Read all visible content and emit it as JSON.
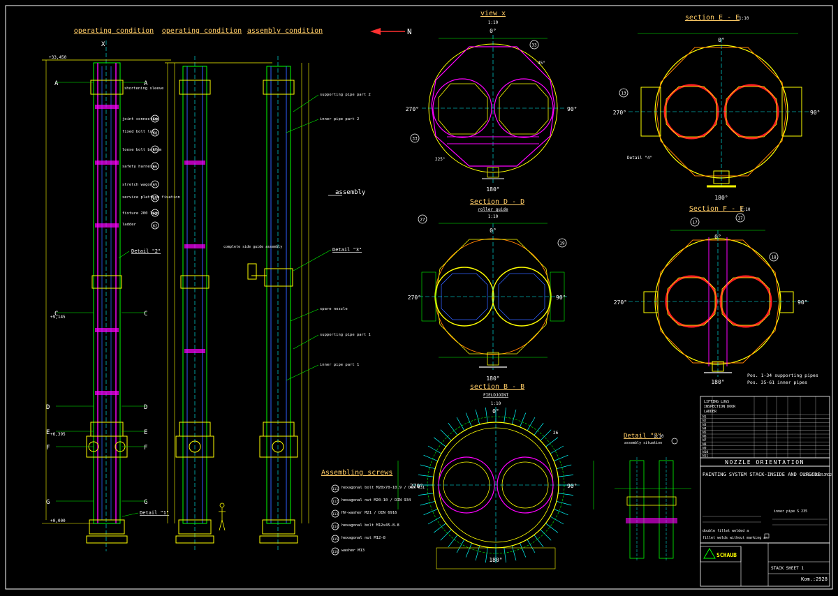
{
  "views": {
    "col1_title": "operating condition",
    "col2_title": "operating condition",
    "col3_title": "assembly condition",
    "north_label": "N",
    "view_x": {
      "title": "view x",
      "scale": "1:10"
    },
    "section_ee": {
      "title": "section E - E",
      "scale": "1:10"
    },
    "section_dd": {
      "title": "Section D - D",
      "subtitle": "roller guide",
      "scale": "1:10"
    },
    "section_ff": {
      "title": "Section F - F",
      "scale": "1:10"
    },
    "section_bb": {
      "title": "section B - B",
      "subtitle": "FIELDJOINT",
      "scale": "1:10"
    },
    "detail3": {
      "title": "Detail \"3\"",
      "scale": "1:10",
      "subtitle": "assembly situation"
    }
  },
  "angles": {
    "a0": "0°",
    "a90": "90°",
    "a180": "180°",
    "a270": "270°",
    "a45": "45°",
    "a225": "225°"
  },
  "section_letters": {
    "A": "A",
    "C": "C",
    "D": "D",
    "E": "E",
    "F": "F",
    "G": "G",
    "X": "X"
  },
  "details": {
    "d1": "Detail \"1\"",
    "d2": "Detail \"2\"",
    "d3": "Detail \"3\"",
    "d4": "Detail \"4\""
  },
  "assembly_marker": "assembly",
  "callouts": [
    {
      "text": "joint connection",
      "num": "69"
    },
    {
      "text": "fixed bolt lug",
      "num": "68"
    },
    {
      "text": "loose bolt bottom",
      "num": "67"
    },
    {
      "text": "safety harness",
      "num": "66"
    },
    {
      "text": "stretch wagon",
      "num": "65"
    },
    {
      "text": "service platform fixation",
      "num": "64"
    },
    {
      "text": "fixture 200 lugs",
      "num": "63"
    },
    {
      "text": "ladder",
      "num": "62"
    }
  ],
  "pipe_labels": {
    "supporting_pipe_2": "supporting pipe part 2",
    "inner_pipe_2": "inner pipe part 2",
    "supporting_pipe_1": "supporting pipe part 1",
    "inner_pipe_1": "inner pipe part 1",
    "spare_nozzle": "spare nozzle",
    "complete_side_guide": "complete side guide assembly"
  },
  "elevations": {
    "top": "+33,450",
    "mid": "+9,145",
    "low": "+6,395",
    "base": "+0,000"
  },
  "section_numbers": {
    "n33a": "33",
    "n33b": "33",
    "n13": "13",
    "n27": "27",
    "n19": "19",
    "n17a": "17",
    "n17b": "17",
    "n18": "18",
    "n26": "26"
  },
  "pos_notes": {
    "line1": "Pos. 1-34 supporting pipes",
    "line2": "Pos. 35-61 inner pipes"
  },
  "screws": {
    "title": "Assembling screws",
    "items": [
      {
        "num": "111",
        "text": "hexagonal bolt M20x70-10.9 / DIN 931"
      },
      {
        "num": "112",
        "text": "hexagonal nut M20-10 / DIN 934"
      },
      {
        "num": "113",
        "text": "HV-washer M21 / DIN 6916"
      },
      {
        "num": "114",
        "text": "hexagonal bolt M12x45-8.8"
      },
      {
        "num": "115",
        "text": "hexagonal nut M12-8"
      },
      {
        "num": "116",
        "text": "washer M13"
      }
    ]
  },
  "nozzle_table": {
    "heading": "NOZZLE ORIENTATION",
    "header_rows": [
      "LIFTING LUGS",
      "INSPECTION DOOR",
      "LADDER"
    ],
    "rows": [
      "N1",
      "N2",
      "N3",
      "N4",
      "N5",
      "N6",
      "N7",
      "N8",
      "N9",
      "N10",
      "N11"
    ]
  },
  "painting": {
    "heading": "PAINTING SYSTEM STACK-INSIDE AND OUTSIDE",
    "note": "ONLY S235JRG2",
    "inner": "inner pipe S 235",
    "weld1": "double fillet welded a",
    "weld2": "fillet welds without marking a="
  },
  "title_block": {
    "logo": "SCHAUB",
    "drawing": "STACK SHEET 1",
    "kom": "Kom.:2928"
  },
  "colors": {
    "bg": "#000000",
    "yellow": "#ffff00",
    "green": "#00ff00",
    "cyan": "#00ffff",
    "magenta": "#ff00ff",
    "red": "#ff2020",
    "orange": "#ff8000",
    "white": "#ffffff",
    "title": "#ffcc66"
  }
}
